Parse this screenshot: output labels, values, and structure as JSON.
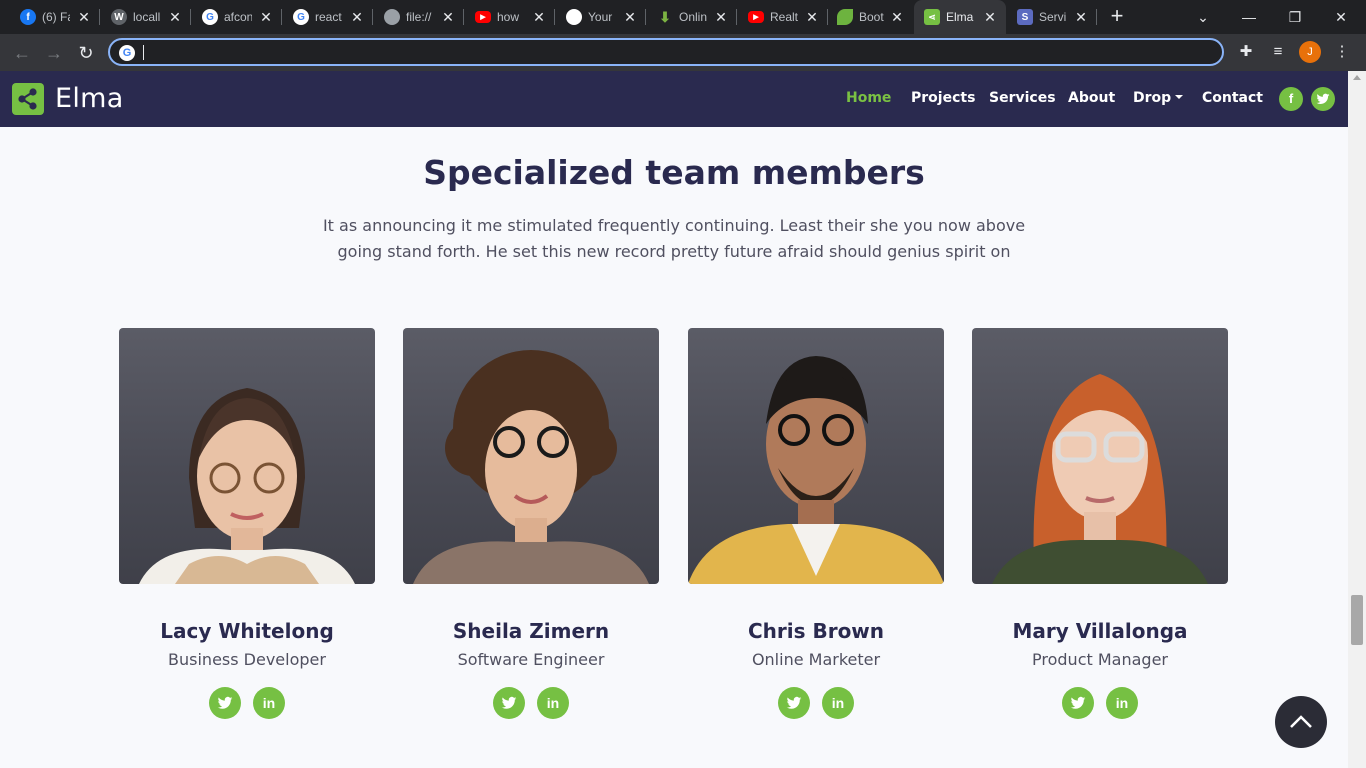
{
  "browser": {
    "tabs": [
      {
        "title": "(6) Fa",
        "icon": "facebook-icon",
        "color": "#1877f2",
        "glyph": "f",
        "active": false
      },
      {
        "title": "locall",
        "icon": "wordpress-icon",
        "color": "#5f6368",
        "glyph": "W",
        "active": false
      },
      {
        "title": "afcon",
        "icon": "google-icon",
        "color": "#ffffff",
        "glyph": "G",
        "active": false
      },
      {
        "title": "react",
        "icon": "google-icon",
        "color": "#ffffff",
        "glyph": "G",
        "active": false
      },
      {
        "title": "file://",
        "icon": "globe-icon",
        "color": "#9aa0a6",
        "glyph": "",
        "active": false
      },
      {
        "title": "how",
        "icon": "youtube-icon",
        "color": "#ff0000",
        "glyph": "",
        "active": false
      },
      {
        "title": "Your",
        "icon": "github-icon",
        "color": "#ffffff",
        "glyph": "",
        "active": false
      },
      {
        "title": "Onlin",
        "icon": "download-icon",
        "color": "#7cb342",
        "glyph": "",
        "active": false
      },
      {
        "title": "Realt",
        "icon": "youtube-icon",
        "color": "#ff0000",
        "glyph": "",
        "active": false
      },
      {
        "title": "Boot",
        "icon": "leaf-icon",
        "color": "#6db33f",
        "glyph": "",
        "active": false
      },
      {
        "title": "Elma",
        "icon": "share-icon",
        "color": "#76c043",
        "glyph": "",
        "active": true
      },
      {
        "title": "Servi",
        "icon": "s-icon",
        "color": "#5c6bc0",
        "glyph": "S",
        "active": false
      }
    ],
    "address_value": "",
    "profile_initial": "J"
  },
  "site": {
    "brand": "Elma",
    "menu": [
      "Home",
      "Projects",
      "Services",
      "About",
      "Drop",
      "Contact"
    ],
    "accent": "#76c043",
    "navy": "#2a2a4f"
  },
  "section": {
    "title": "Specialized team members",
    "text": "It as announcing it me stimulated frequently continuing. Least their she you now above going stand forth. He set this new record pretty future afraid should genius spirit on"
  },
  "team": [
    {
      "name": "Lacy Whitelong",
      "role": "Business Developer"
    },
    {
      "name": "Sheila Zimern",
      "role": "Software Engineer"
    },
    {
      "name": "Chris Brown",
      "role": "Online Marketer"
    },
    {
      "name": "Mary Villalonga",
      "role": "Product Manager"
    }
  ]
}
